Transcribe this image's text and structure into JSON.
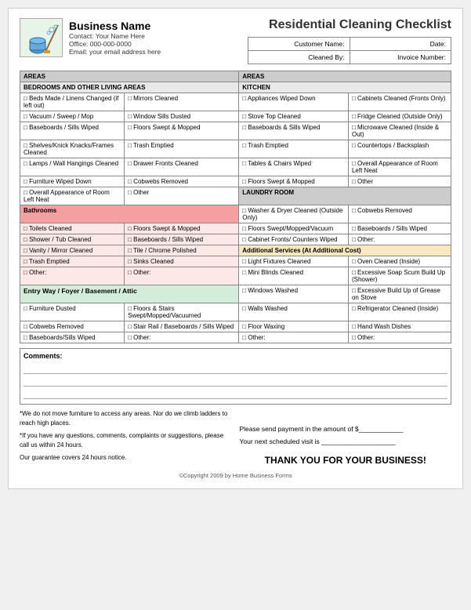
{
  "header": {
    "title": "Residential Cleaning Checklist",
    "business_name": "Business Name",
    "contact": "Contact:  Your Name Here",
    "office": "Office:  000-000-0000",
    "email": "Email:  your email address here",
    "customer_name_label": "Customer Name:",
    "date_label": "Date:",
    "cleaned_by_label": "Cleaned By:",
    "invoice_label": "Invoice Number:"
  },
  "areas_label_left": "AREAS",
  "areas_label_right": "AREAS",
  "bedrooms_header": "BEDROOMS AND OTHER LIVING AREAS",
  "bedroom_items_col1": [
    "Beds Made / Linens Changed (if left out)",
    "Vacuum / Sweep / Mop",
    "Baseboards / Sills Wiped",
    "Shelves/Knick Knacks/Frames Cleaned",
    "Lamps / Wall Hangings Cleaned",
    "Furniture Wiped Down",
    "Overall Appearance of Room Left Neat"
  ],
  "bedroom_items_col2": [
    "Mirrors Cleaned",
    "Window Sills Dusted",
    "Floors Swept & Mopped",
    "Trash Emptied",
    "Drawer Fronts Cleaned",
    "Cobwebs Removed",
    "Other"
  ],
  "kitchen_header": "KITCHEN",
  "kitchen_items_col1": [
    "Appliances Wiped Down",
    "Stove Top Cleaned",
    "Baseboards & Sills Wiped",
    "Trash Emptied",
    "Tables & Chairs Wiped",
    "Floors Swept & Mopped"
  ],
  "kitchen_items_col2": [
    "Cabinets Cleaned (Fronts Only)",
    "Fridge Cleaned (Outside Only)",
    "Microwave Cleaned (Inside & Out)",
    "Countertops / Backsplash",
    "Overall Appearance of Room Left Neat",
    "Other"
  ],
  "bathrooms_header": "Bathrooms",
  "bathroom_items_col1": [
    "Toilets Cleaned",
    "Shower / Tub Cleaned",
    "Vanity / Mirror Cleaned",
    "Trash Emptied",
    "Other:"
  ],
  "bathroom_items_col2": [
    "Floors Swept & Mopped",
    "Baseboards / Sills Wiped",
    "Tile / Chrome Polished",
    "Sinks Cleaned",
    "Other:"
  ],
  "entry_header": "Entry Way / Foyer / Basement / Attic",
  "entry_items_col1": [
    "Furniture Dusted",
    "Cobwebs Removed",
    "Baseboards/Sills Wiped"
  ],
  "entry_items_col2": [
    "Floors & Stairs Swept/Mopped/Vacuumed",
    "Stair Rail / Baseboards / Sills Wiped",
    "Other:"
  ],
  "laundry_header": "LAUNDRY ROOM",
  "laundry_items_col1": [
    "Washer & Dryer Cleaned (Outside Only)",
    "Floors Swept/Mopped/Vacuum",
    "Cabinet Fronts/ Counters Wiped"
  ],
  "laundry_items_col2": [
    "Cobwebs Removed",
    "Baseboards / Sills Wiped",
    "Other:"
  ],
  "additional_header": "Additional Services (At Additional Cost)",
  "additional_items_col1": [
    "Light Fixtures Cleaned",
    "Mini Blinds Cleaned",
    "Windows Washed",
    "Walls Washed",
    "Floor Waxing",
    "Other:"
  ],
  "additional_items_col2": [
    "Oven Cleaned (Inside)",
    "Excessive Soap Scum Build Up (Shower)",
    "Excessive Build Up of Grease on Stove",
    "Refrigerator Cleaned (Inside)",
    "Hand Wash Dishes",
    "Other:"
  ],
  "comments_label": "Comments:",
  "footer": {
    "note1": "*We do not move furniture to access any areas.  Nor do we climb ladders to reach high places.",
    "note2": "*If you have any questions, comments, complaints or suggestions, please call us within 24 hours.",
    "note3": "Our guarantee covers 24 hours notice.",
    "payment_line": "Please send payment in the amount of $____________",
    "visit_line": "Your next scheduled visit is  ____________________",
    "thank_you": "THANK YOU FOR YOUR BUSINESS!"
  },
  "copyright": "©Copyright 2009 by Home Business Forms"
}
